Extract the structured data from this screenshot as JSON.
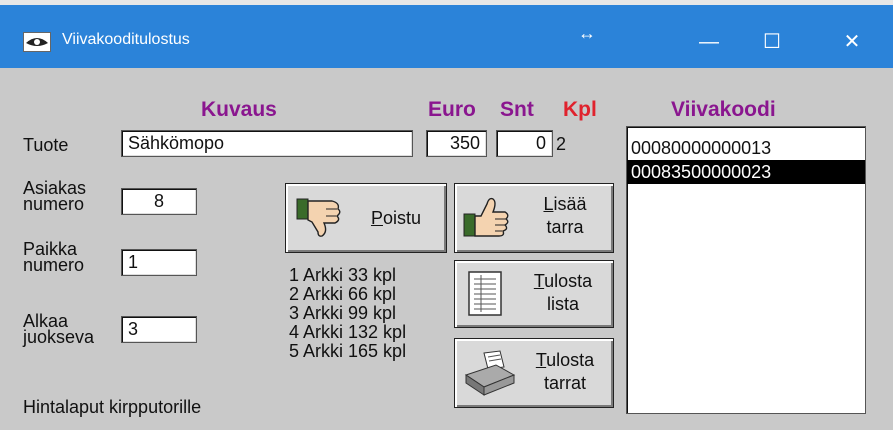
{
  "window": {
    "title": "Viivakooditulostus",
    "resize_glyph": "↔",
    "controls": {
      "minimize": "—",
      "maximize": "☐",
      "close": "✕"
    }
  },
  "headers": {
    "description": "Kuvaus",
    "euro": "Euro",
    "cents": "Snt",
    "qty": "Kpl",
    "barcode": "Viivakoodi"
  },
  "product": {
    "label": "Tuote",
    "name": "Sähkömopo",
    "euro": "350",
    "cents": "0",
    "qty": "2"
  },
  "customer": {
    "label_line1": "Asiakas",
    "label_line2": "numero",
    "value": "8"
  },
  "place": {
    "label_line1": "Paikka",
    "label_line2": "numero",
    "value": "1"
  },
  "start": {
    "label_line1": "Alkaa",
    "label_line2": "juokseva",
    "value": "3"
  },
  "footer": "Hintalaput kirpputorille",
  "buttons": {
    "exit": {
      "mnemonic": "P",
      "rest": "oistu"
    },
    "add": {
      "mnemonic": "L",
      "rest": "isää",
      "line2": "tarra"
    },
    "print_list": {
      "mnemonic": "T",
      "rest": "ulosta",
      "line2": "lista"
    },
    "print_labels": {
      "mnemonic": "T",
      "rest": "ulosta",
      "line2": "tarrat"
    }
  },
  "sheets": [
    "1 Arkki 33 kpl",
    "2 Arkki 66 kpl",
    "3 Arkki 99 kpl",
    "4 Arkki 132 kpl",
    "5 Arkki 165 kpl"
  ],
  "barcodes": [
    "00080000000013",
    "00083500000023"
  ],
  "selected_barcode_index": 1,
  "colors": {
    "title_bar": "#2b83d9",
    "header_purple": "#8a168f",
    "header_red": "#e0222d",
    "window_bg": "#c9c9c9"
  }
}
